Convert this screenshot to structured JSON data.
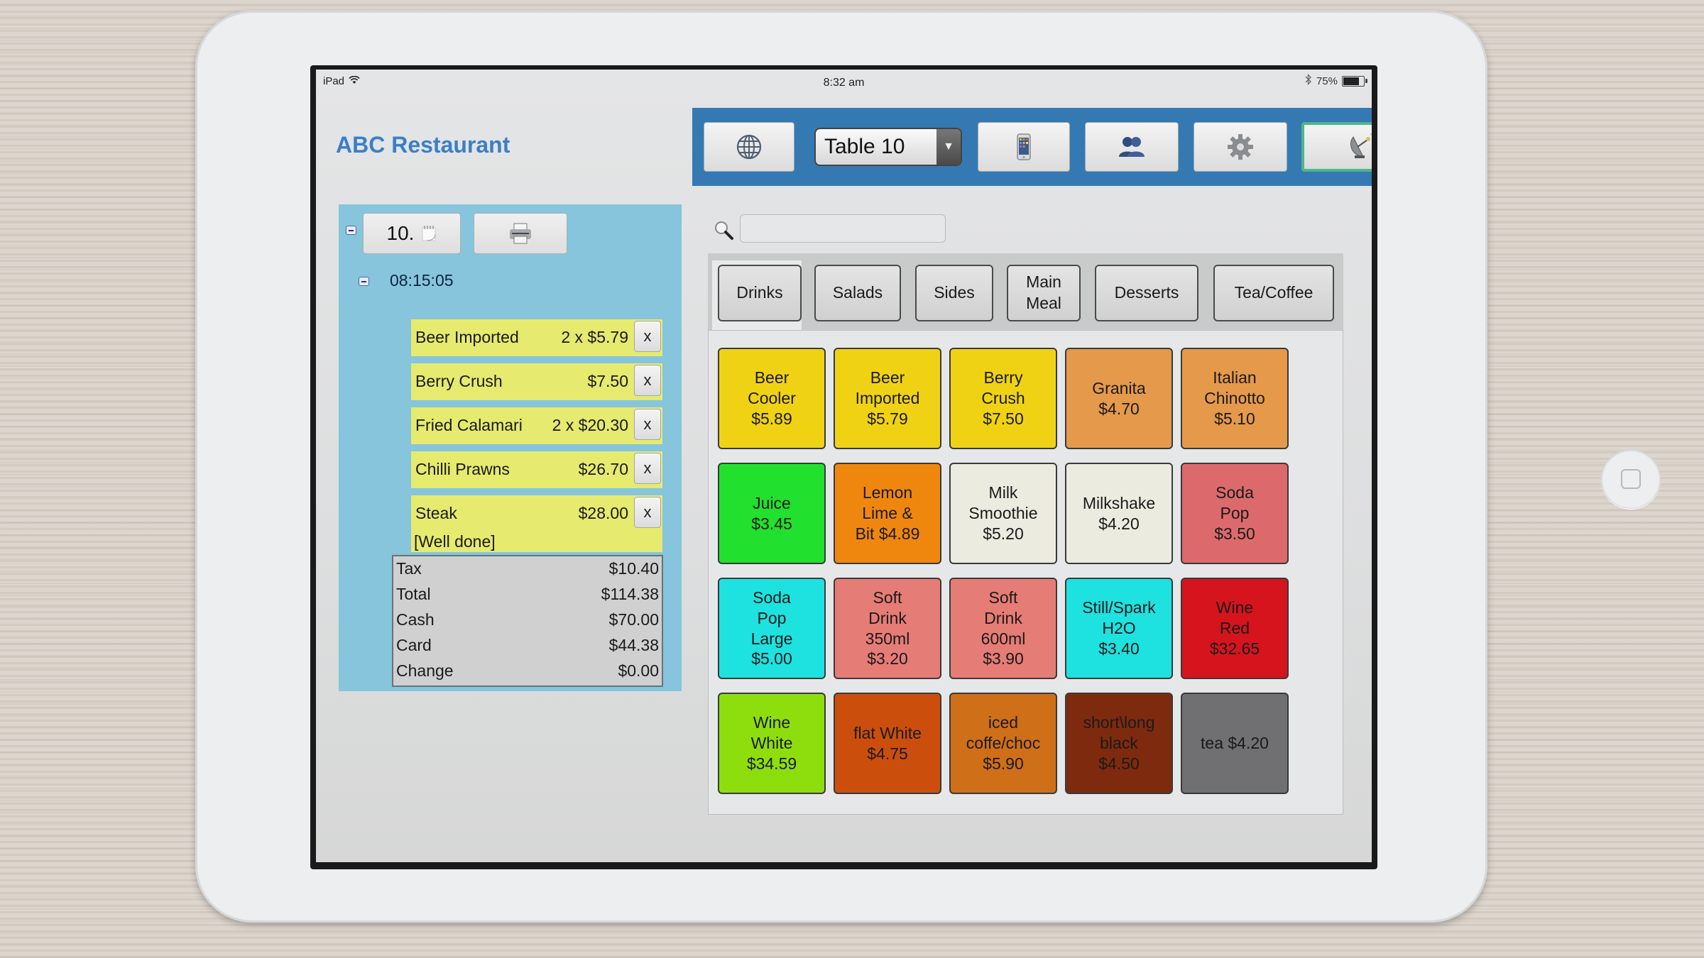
{
  "status_bar": {
    "device": "iPad",
    "time": "8:32 am",
    "battery": "75%",
    "battery_level": 0.75
  },
  "app": {
    "title": "ABC Restaurant"
  },
  "toolbar": {
    "buttons": [
      {
        "name": "globe",
        "icon": "globe-icon"
      },
      {
        "name": "phone",
        "icon": "phone-icon"
      },
      {
        "name": "users",
        "icon": "users-icon"
      },
      {
        "name": "settings",
        "icon": "gear-icon"
      },
      {
        "name": "satellite",
        "icon": "satellite-dish-icon"
      }
    ],
    "table_select": {
      "value": "Table 10"
    },
    "colors": {
      "bar": "#3579b2",
      "active_outline": "#4fb58a"
    }
  },
  "order": {
    "order_number": "10.",
    "timestamp": "08:15:05",
    "items": [
      {
        "name": "Beer Imported",
        "price": "2 x $5.79",
        "remove": "x"
      },
      {
        "name": "Berry Crush",
        "price": "$7.50",
        "remove": "x"
      },
      {
        "name": "Fried Calamari",
        "price": "2 x $20.30",
        "remove": "x"
      },
      {
        "name": "Chilli Prawns",
        "price": "$26.70",
        "remove": "x"
      },
      {
        "name": "Steak",
        "price": "$28.00",
        "remove": "x",
        "note": "[Well done]"
      }
    ],
    "totals": [
      {
        "label": "Tax",
        "amount": "$10.40"
      },
      {
        "label": "Total",
        "amount": "$114.38"
      },
      {
        "label": "Cash",
        "amount": "$70.00"
      },
      {
        "label": "Card",
        "amount": "$44.38"
      },
      {
        "label": "Change",
        "amount": "$0.00"
      }
    ]
  },
  "search": {
    "value": "",
    "placeholder": ""
  },
  "categories": {
    "active": "Drinks",
    "tabs": [
      {
        "label": "Drinks"
      },
      {
        "label": "Salads"
      },
      {
        "label": "Sides"
      },
      {
        "label": "Main\nMeal"
      },
      {
        "label": "Desserts"
      },
      {
        "label": "Tea/Coffee"
      }
    ]
  },
  "products": [
    {
      "label": "Beer\nCooler\n$5.89",
      "color": "#f0d214"
    },
    {
      "label": "Beer\nImported\n$5.79",
      "color": "#f0d214"
    },
    {
      "label": "Berry\nCrush\n$7.50",
      "color": "#f0d214"
    },
    {
      "label": "Granita\n$4.70",
      "color": "#e5994a"
    },
    {
      "label": "Italian\nChinotto\n$5.10",
      "color": "#e5994a"
    },
    {
      "label": "Juice\n$3.45",
      "color": "#22e02e"
    },
    {
      "label": "Lemon\nLime &\nBit $4.89",
      "color": "#ef870f"
    },
    {
      "label": "Milk\nSmoothie\n$5.20",
      "color": "#ecebdf"
    },
    {
      "label": "Milkshake\n$4.20",
      "color": "#ecebdf"
    },
    {
      "label": "Soda\nPop\n$3.50",
      "color": "#dc6a6c"
    },
    {
      "label": "Soda\nPop\nLarge\n$5.00",
      "color": "#1de2e0"
    },
    {
      "label": "Soft\nDrink\n350ml\n$3.20",
      "color": "#e67c76"
    },
    {
      "label": "Soft\nDrink\n600ml\n$3.90",
      "color": "#e67c76"
    },
    {
      "label": "Still/Spark\nH2O\n$3.40",
      "color": "#1de2e0"
    },
    {
      "label": "Wine\nRed\n$32.65",
      "color": "#d6141d"
    },
    {
      "label": "Wine\nWhite\n$34.59",
      "color": "#8ede0e"
    },
    {
      "label": "flat White\n$4.75",
      "color": "#cc4e0d"
    },
    {
      "label": "iced\ncoffe/choc\n$5.90",
      "color": "#cf6f18"
    },
    {
      "label": "short\\long\nblack\n$4.50",
      "color": "#7e2a0e"
    },
    {
      "label": "tea $4.20",
      "color": "#707073"
    }
  ]
}
